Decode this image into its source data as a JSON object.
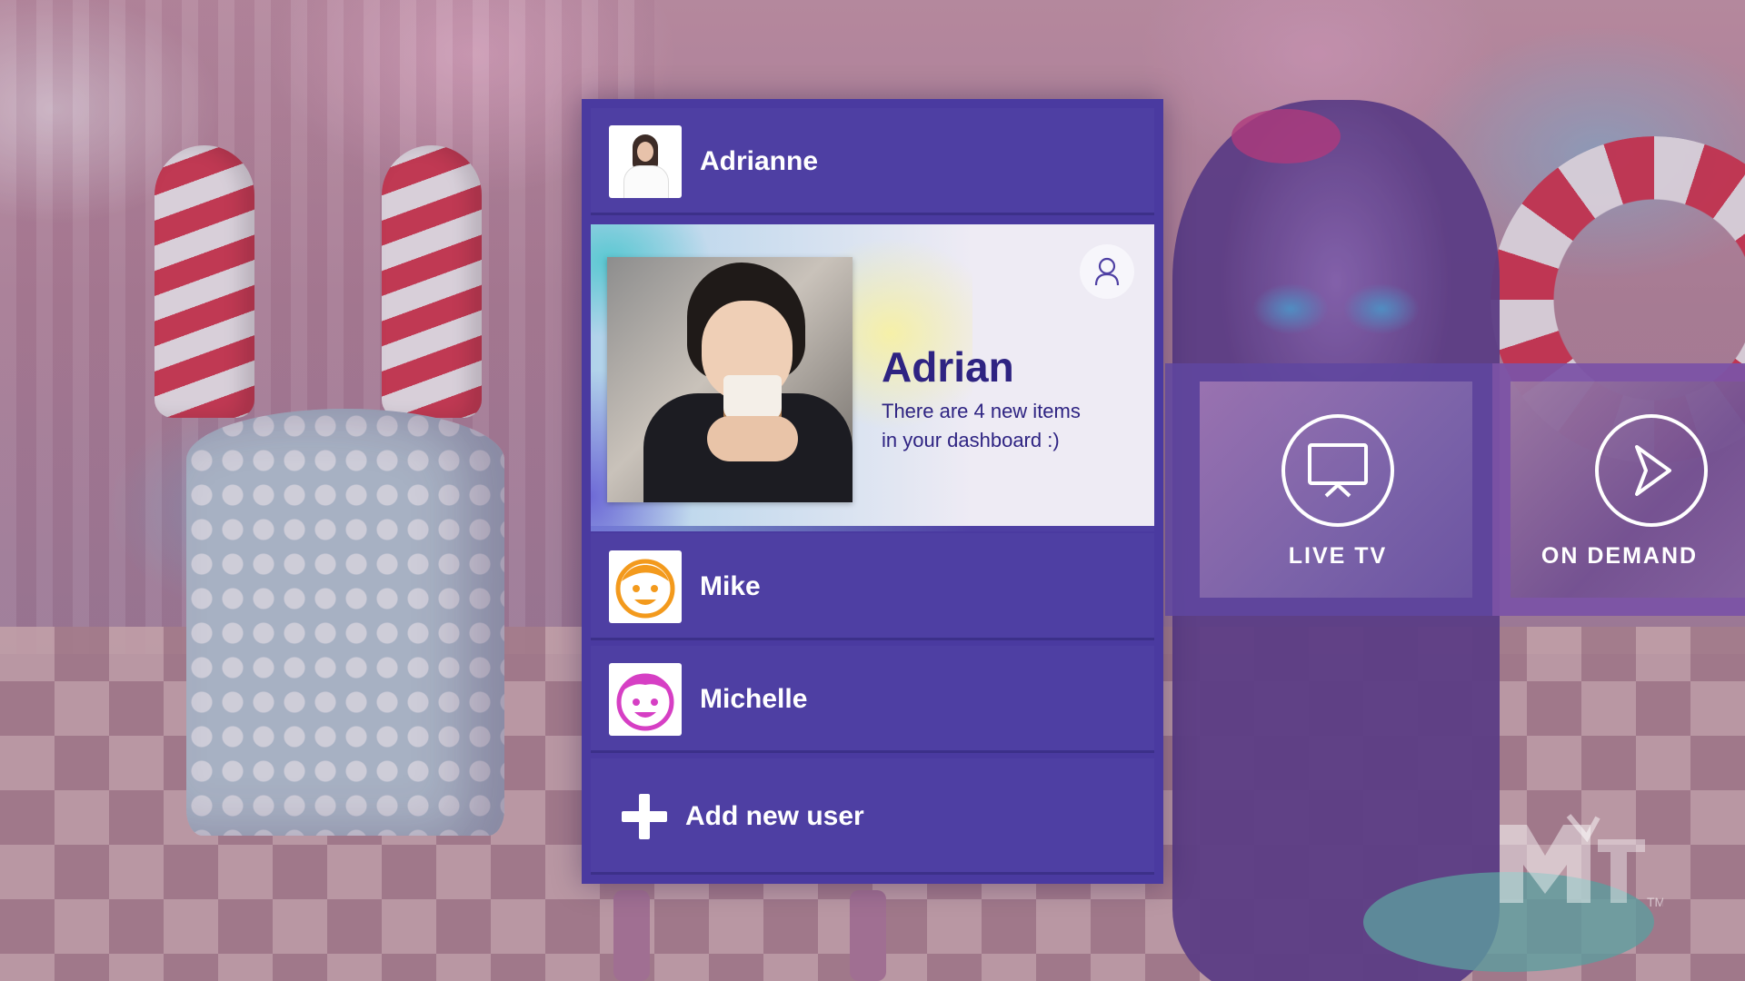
{
  "users": {
    "adrianne": {
      "name": "Adrianne",
      "avatar": "photo-avatar"
    },
    "selected": {
      "name": "Adrian",
      "message": "There are 4 new items in your dashboard :)",
      "profile_icon": "person-icon"
    },
    "mike": {
      "name": "Mike",
      "avatar": "orange-smiley-face",
      "color": "#f39a1d"
    },
    "michelle": {
      "name": "Michelle",
      "avatar": "pink-smiley-face",
      "color": "#d63fc4"
    },
    "add_user_label": "Add new user"
  },
  "tiles": [
    {
      "label": "LIVE TV",
      "icon": "tv-screen-icon"
    },
    {
      "label": "ON DEMAND",
      "icon": "play-icon"
    }
  ],
  "logo": {
    "text": "MTV",
    "mark": "TM"
  },
  "colors": {
    "panel": "#4a3aa0",
    "row": "#4e3fa3",
    "card": "#eeebf4",
    "accent_text": "#2e2382"
  }
}
